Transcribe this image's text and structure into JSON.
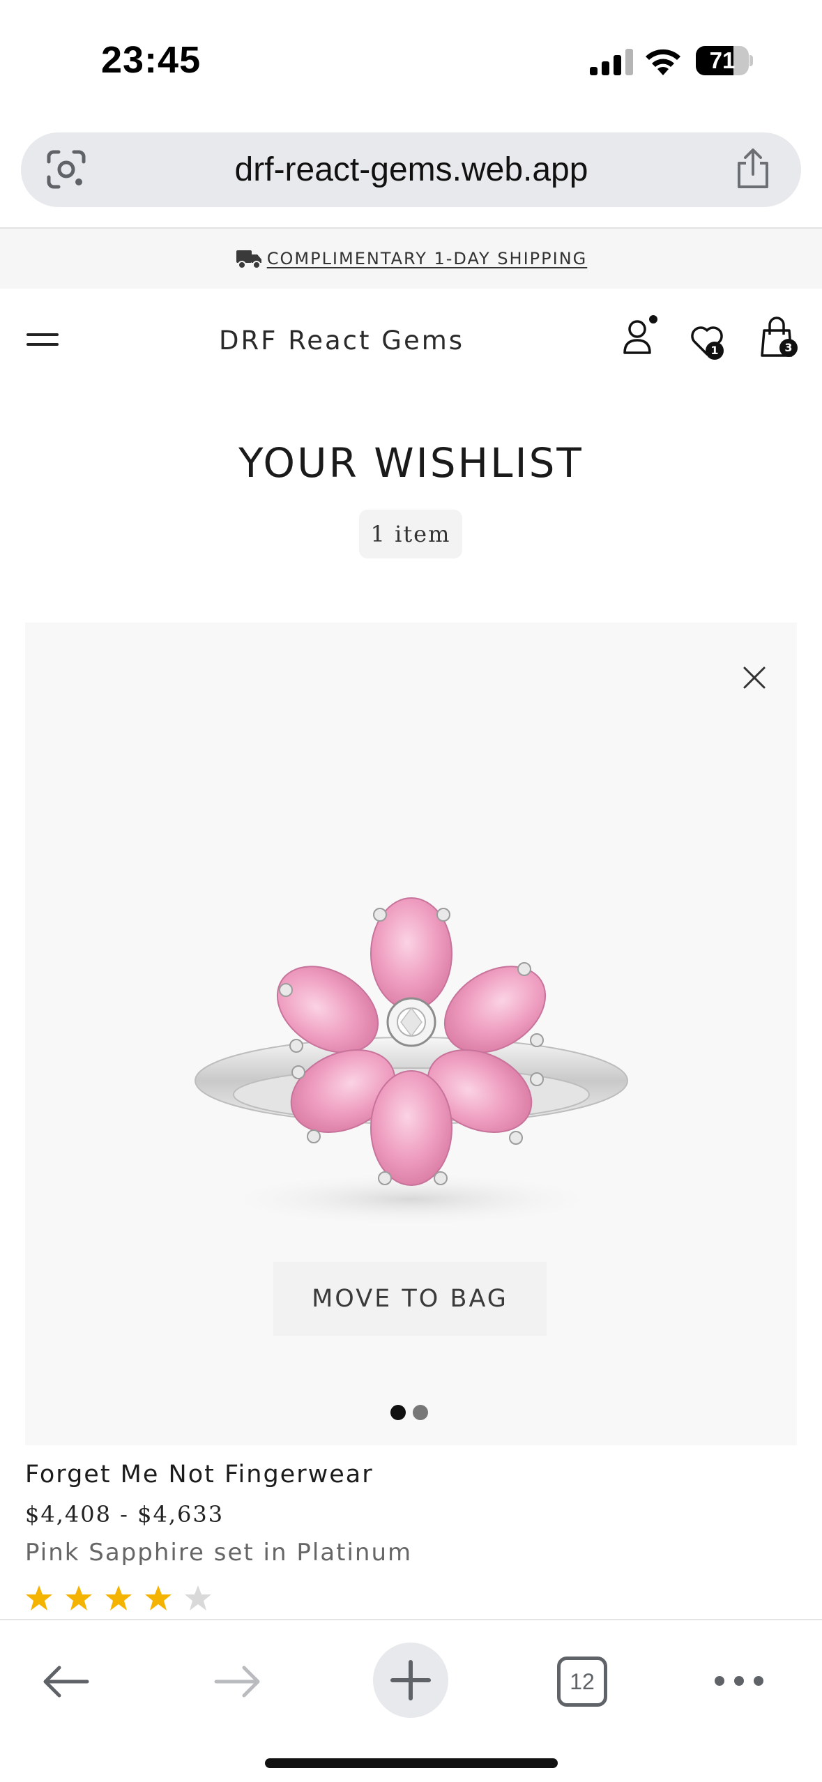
{
  "status_bar": {
    "time": "23:45",
    "battery_level": "71"
  },
  "browser": {
    "url": "drf-react-gems.web.app",
    "tab_count": "12"
  },
  "announcement": {
    "text": "COMPLIMENTARY 1-DAY SHIPPING",
    "icon": "truck-icon"
  },
  "header": {
    "brand": "DRF React Gems",
    "wishlist_count": "1",
    "bag_count": "3",
    "icons": [
      "menu-icon",
      "account-icon",
      "heart-icon",
      "shopping-bag-icon"
    ]
  },
  "wishlist": {
    "title": "YOUR WISHLIST",
    "item_count": "1 item"
  },
  "product": {
    "name": "Forget Me Not Fingerwear",
    "price": "$4,408 - $4,633",
    "description": "Pink Sapphire set in Platinum",
    "move_to_bag_label": "MOVE TO BAG",
    "rating": 4,
    "rating_max": 5,
    "image_count": 2,
    "active_image": 0
  },
  "colors": {
    "star_filled": "#f5b301",
    "star_empty": "#d9d9d9",
    "gem_pink": "#ef9fc1",
    "card_background": "#f8f8f8"
  }
}
